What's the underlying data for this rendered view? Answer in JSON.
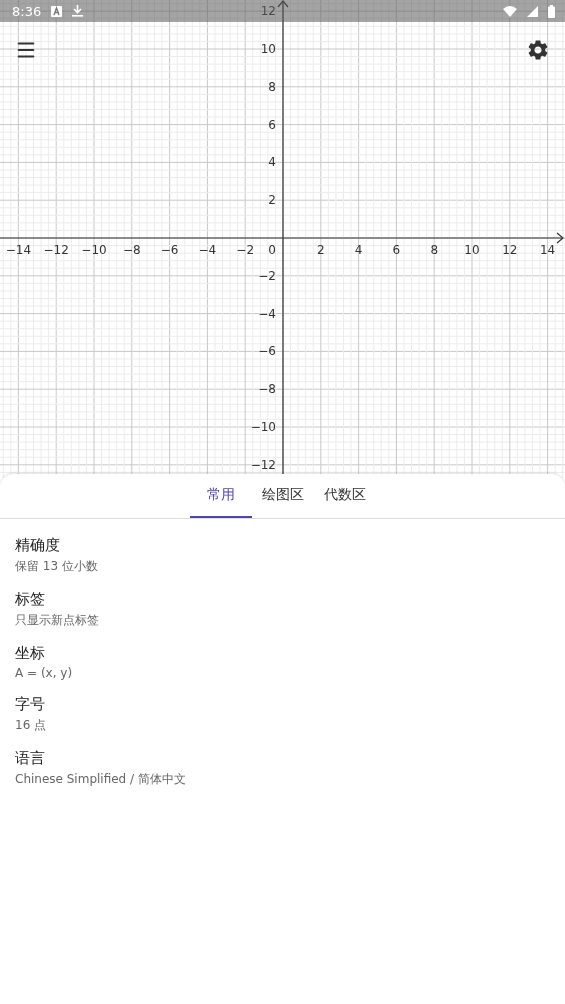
{
  "status_bar": {
    "time": "8:36"
  },
  "graph": {
    "origin_label": "0",
    "x_labels": [
      "−14",
      "−12",
      "−10",
      "−8",
      "−6",
      "−4",
      "−2",
      "2",
      "4",
      "6",
      "8",
      "10",
      "12",
      "14"
    ],
    "y_labels": [
      "12",
      "10",
      "8",
      "6",
      "4",
      "2",
      "−2",
      "−4",
      "−6",
      "−8",
      "−10",
      "−12"
    ]
  },
  "tabs": [
    {
      "label": "常用",
      "selected": true
    },
    {
      "label": "绘图区",
      "selected": false
    },
    {
      "label": "代数区",
      "selected": false
    }
  ],
  "settings": [
    {
      "title": "精确度",
      "value": "保留 13 位小数"
    },
    {
      "title": "标签",
      "value": "只显示新点标签"
    },
    {
      "title": "坐标",
      "value": "A = (x, y)"
    },
    {
      "title": "字号",
      "value": "16 点"
    },
    {
      "title": "语言",
      "value": "Chinese Simplified / 简体中文"
    }
  ]
}
